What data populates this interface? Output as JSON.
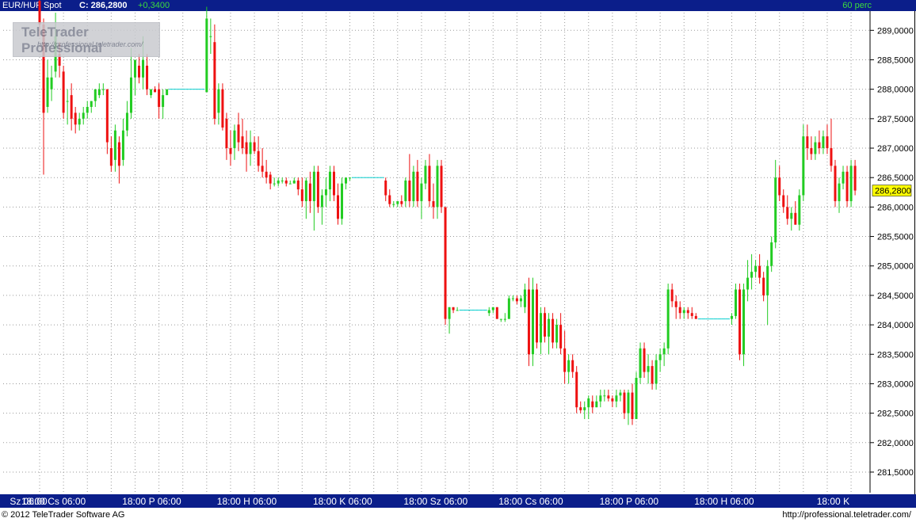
{
  "header": {
    "symbol": "EUR/HUF Spot",
    "close_label": "C: 286,2800",
    "change": "+0,3400",
    "interval": "60 perc"
  },
  "watermark": {
    "brand": "TeleTrader Professional",
    "url": "http://professional.teletrader.com/"
  },
  "footer": {
    "copyright": "© 2012 TeleTrader Software AG",
    "url": "http://professional.teletrader.com/"
  },
  "colors": {
    "up": "#22cc22",
    "down": "#ee1111",
    "background": "#ffffff",
    "bar": "#0b1e8a",
    "last_price_tag": "#ffff00",
    "connector": "#00cccc"
  },
  "chart_data": {
    "type": "candlestick",
    "ylim": [
      281.15,
      289.3
    ],
    "y_axis_side": "right",
    "grid": true,
    "last_price": 286.28,
    "last_price_label": "286,2800",
    "y_ticks": [
      {
        "value": 281.5,
        "label": "281,5000"
      },
      {
        "value": 282.0,
        "label": "282,0000"
      },
      {
        "value": 282.5,
        "label": "282,5000"
      },
      {
        "value": 283.0,
        "label": "283,0000"
      },
      {
        "value": 283.5,
        "label": "283,5000"
      },
      {
        "value": 284.0,
        "label": "284,0000"
      },
      {
        "value": 284.5,
        "label": "284,5000"
      },
      {
        "value": 285.0,
        "label": "285,0000"
      },
      {
        "value": 285.5,
        "label": "285,5000"
      },
      {
        "value": 286.0,
        "label": "286,0000"
      },
      {
        "value": 286.5,
        "label": "286,5000"
      },
      {
        "value": 287.0,
        "label": "287,0000"
      },
      {
        "value": 287.5,
        "label": "287,5000"
      },
      {
        "value": 288.0,
        "label": "288,0000"
      },
      {
        "value": 288.5,
        "label": "288,5000"
      },
      {
        "value": 289.0,
        "label": "289,0000"
      }
    ],
    "x_ticks": [
      {
        "i": 0,
        "label": "Sz 06:00"
      },
      {
        "i": 12,
        "label": "18:00 Cs 06:00"
      },
      {
        "i": 36,
        "label": "18:00  P  06:00"
      },
      {
        "i": 60,
        "label": "18:00  H  06:00"
      },
      {
        "i": 84,
        "label": "18:00  K  06:00"
      },
      {
        "i": 108,
        "label": "18:00 Sz 06:00"
      },
      {
        "i": 132,
        "label": "18:00 Cs 06:00"
      },
      {
        "i": 156,
        "label": "18:00  P  06:00"
      },
      {
        "i": 180,
        "label": "18:00  H  06:00"
      },
      {
        "i": 204,
        "label": "18:00  K"
      }
    ],
    "grid_indices": [
      0,
      6,
      12,
      18,
      24,
      30,
      36,
      42,
      48,
      54,
      60,
      66,
      72,
      78,
      84,
      90,
      96,
      102,
      108,
      114,
      120,
      126,
      132,
      138,
      144,
      150,
      156,
      162,
      168,
      174,
      180,
      186,
      192,
      198,
      204
    ],
    "ohlc": [
      [
        289.5,
        289.6,
        288.9,
        289.1
      ],
      [
        289.1,
        289.2,
        286.55,
        287.6
      ],
      [
        287.7,
        288.5,
        287.6,
        288.2
      ],
      [
        288.0,
        288.4,
        287.8,
        288.2
      ],
      [
        288.3,
        289.3,
        288.2,
        288.9
      ],
      [
        288.6,
        288.8,
        288.2,
        288.4
      ],
      [
        288.3,
        288.4,
        287.5,
        287.6
      ],
      [
        287.8,
        288.0,
        287.4,
        287.8
      ],
      [
        287.9,
        288.1,
        287.3,
        287.5
      ],
      [
        287.6,
        287.7,
        287.25,
        287.4
      ],
      [
        287.4,
        287.6,
        287.3,
        287.5
      ],
      [
        287.5,
        287.7,
        287.4,
        287.6
      ],
      [
        287.6,
        287.8,
        287.5,
        287.7
      ],
      [
        287.7,
        287.8,
        287.6,
        287.8
      ],
      [
        287.8,
        288.0,
        287.7,
        288.0
      ],
      [
        287.9,
        288.1,
        287.85,
        288.0
      ],
      [
        288.0,
        288.1,
        287.9,
        288.0
      ],
      [
        288.0,
        288.0,
        286.9,
        287.1
      ],
      [
        287.0,
        287.2,
        286.6,
        286.7
      ],
      [
        286.8,
        287.4,
        286.6,
        287.3
      ],
      [
        287.1,
        287.2,
        286.4,
        286.7
      ],
      [
        286.8,
        287.5,
        286.7,
        287.3
      ],
      [
        287.3,
        287.8,
        287.2,
        287.6
      ],
      [
        287.6,
        288.7,
        287.5,
        288.2
      ],
      [
        288.2,
        288.5,
        287.9,
        288.5
      ],
      [
        288.4,
        288.6,
        288.1,
        288.2
      ],
      [
        288.2,
        288.9,
        288.0,
        288.5
      ],
      [
        288.4,
        288.6,
        287.9,
        288.0
      ],
      [
        287.9,
        288.0,
        287.85,
        288.0
      ],
      [
        288.0,
        288.05,
        287.95,
        287.95
      ],
      [
        288.0,
        288.1,
        287.5,
        287.7
      ],
      [
        287.7,
        288.0,
        287.5,
        287.9
      ],
      [
        287.9,
        288.0,
        287.9,
        288.0
      ],
      [
        288.0,
        288.0,
        288.0,
        288.0
      ],
      [
        288.0,
        288.0,
        288.0,
        288.0
      ],
      [
        288.0,
        288.0,
        288.0,
        288.0
      ],
      [
        288.0,
        288.0,
        288.0,
        288.0
      ],
      [
        288.0,
        288.0,
        288.0,
        288.0
      ],
      [
        288.0,
        288.0,
        288.0,
        288.0
      ],
      [
        288.0,
        288.0,
        288.0,
        288.0
      ],
      [
        288.0,
        288.0,
        288.0,
        288.0
      ],
      [
        288.0,
        288.0,
        288.0,
        288.0
      ],
      [
        287.95,
        289.4,
        287.95,
        289.2
      ],
      [
        288.9,
        289.2,
        288.6,
        288.9
      ],
      [
        288.8,
        289.1,
        287.4,
        287.5
      ],
      [
        287.6,
        288.1,
        287.4,
        288.0
      ],
      [
        288.0,
        288.1,
        287.3,
        287.35
      ],
      [
        287.5,
        287.6,
        286.8,
        287.0
      ],
      [
        287.0,
        287.3,
        286.7,
        286.9
      ],
      [
        287.0,
        287.4,
        286.8,
        287.3
      ],
      [
        287.4,
        287.6,
        286.95,
        287.1
      ],
      [
        287.2,
        287.5,
        286.9,
        287.0
      ],
      [
        287.1,
        287.3,
        286.6,
        286.9
      ],
      [
        286.9,
        287.3,
        286.7,
        287.1
      ],
      [
        287.1,
        287.2,
        286.9,
        286.95
      ],
      [
        286.95,
        287.2,
        286.6,
        286.7
      ],
      [
        286.7,
        287.0,
        286.5,
        286.6
      ],
      [
        286.6,
        286.8,
        286.4,
        286.5
      ],
      [
        286.55,
        286.6,
        286.3,
        286.4
      ],
      [
        286.4,
        286.5,
        286.35,
        286.4
      ],
      [
        286.4,
        286.5,
        286.35,
        286.45
      ],
      [
        286.45,
        286.5,
        286.4,
        286.45
      ],
      [
        286.45,
        286.5,
        286.35,
        286.4
      ],
      [
        286.4,
        286.45,
        286.4,
        286.4
      ],
      [
        286.4,
        286.5,
        286.4,
        286.45
      ],
      [
        286.45,
        286.5,
        286.2,
        286.3
      ],
      [
        286.3,
        286.5,
        286.0,
        286.1
      ],
      [
        286.1,
        286.5,
        285.8,
        286.45
      ],
      [
        286.4,
        286.6,
        285.9,
        286.1
      ],
      [
        286.1,
        286.7,
        285.6,
        286.6
      ],
      [
        286.6,
        286.7,
        285.9,
        286.0
      ],
      [
        286.0,
        286.3,
        285.7,
        286.2
      ],
      [
        286.2,
        286.5,
        286.0,
        286.3
      ],
      [
        286.3,
        286.7,
        286.1,
        286.6
      ],
      [
        286.6,
        286.7,
        286.1,
        286.2
      ],
      [
        286.2,
        286.4,
        285.7,
        285.8
      ],
      [
        285.8,
        286.5,
        285.7,
        286.4
      ],
      [
        286.4,
        286.5,
        286.3,
        286.5
      ],
      [
        286.5,
        286.5,
        286.45,
        286.5
      ],
      [
        286.5,
        286.5,
        286.5,
        286.5
      ],
      [
        286.5,
        286.5,
        286.5,
        286.5
      ],
      [
        286.5,
        286.5,
        286.5,
        286.5
      ],
      [
        286.5,
        286.5,
        286.5,
        286.5
      ],
      [
        286.5,
        286.5,
        286.5,
        286.5
      ],
      [
        286.5,
        286.5,
        286.5,
        286.5
      ],
      [
        286.5,
        286.5,
        286.5,
        286.5
      ],
      [
        286.5,
        286.5,
        286.5,
        286.5
      ],
      [
        286.45,
        286.5,
        286.1,
        286.2
      ],
      [
        286.2,
        286.3,
        286.0,
        286.05
      ],
      [
        286.05,
        286.1,
        286.0,
        286.05
      ],
      [
        286.05,
        286.1,
        286.0,
        286.1
      ],
      [
        286.1,
        286.2,
        286.0,
        286.05
      ],
      [
        286.1,
        286.5,
        286.0,
        286.45
      ],
      [
        286.45,
        286.9,
        286.0,
        286.1
      ],
      [
        286.1,
        286.7,
        286.0,
        286.6
      ],
      [
        286.6,
        286.8,
        286.0,
        286.1
      ],
      [
        286.1,
        286.5,
        285.8,
        286.4
      ],
      [
        286.4,
        286.8,
        286.3,
        286.7
      ],
      [
        286.7,
        286.9,
        286.0,
        286.1
      ],
      [
        286.1,
        286.4,
        285.8,
        286.0
      ],
      [
        286.0,
        286.8,
        285.8,
        286.7
      ],
      [
        286.7,
        286.8,
        285.9,
        286.0
      ],
      [
        286.0,
        285.9,
        284.0,
        284.1
      ],
      [
        284.1,
        284.3,
        283.85,
        284.3
      ],
      [
        284.3,
        284.3,
        284.2,
        284.25
      ],
      [
        284.25,
        284.3,
        284.25,
        284.25
      ],
      [
        284.25,
        284.25,
        284.25,
        284.25
      ],
      [
        284.25,
        284.25,
        284.25,
        284.25
      ],
      [
        284.25,
        284.25,
        284.25,
        284.25
      ],
      [
        284.25,
        284.25,
        284.25,
        284.25
      ],
      [
        284.25,
        284.25,
        284.25,
        284.25
      ],
      [
        284.25,
        284.25,
        284.25,
        284.25
      ],
      [
        284.25,
        284.25,
        284.25,
        284.25
      ],
      [
        284.2,
        284.3,
        284.15,
        284.25
      ],
      [
        284.25,
        284.3,
        284.2,
        284.3
      ],
      [
        284.3,
        284.3,
        284.1,
        284.1
      ],
      [
        284.1,
        284.1,
        284.05,
        284.1
      ],
      [
        284.1,
        284.2,
        284.05,
        284.1
      ],
      [
        284.1,
        284.5,
        284.1,
        284.45
      ],
      [
        284.45,
        284.5,
        284.4,
        284.45
      ],
      [
        284.45,
        284.5,
        284.35,
        284.4
      ],
      [
        284.4,
        284.5,
        284.3,
        284.45
      ],
      [
        284.3,
        284.7,
        284.2,
        284.6
      ],
      [
        284.6,
        284.8,
        283.3,
        283.5
      ],
      [
        283.5,
        284.8,
        283.3,
        284.6
      ],
      [
        284.6,
        284.7,
        283.6,
        283.7
      ],
      [
        283.7,
        284.3,
        283.5,
        284.2
      ],
      [
        284.2,
        284.3,
        283.7,
        283.8
      ],
      [
        283.8,
        284.2,
        283.5,
        284.1
      ],
      [
        284.1,
        284.2,
        283.6,
        283.7
      ],
      [
        283.7,
        284.1,
        283.6,
        284.0
      ],
      [
        284.0,
        284.2,
        283.5,
        283.6
      ],
      [
        283.6,
        283.9,
        283.0,
        283.2
      ],
      [
        283.2,
        283.5,
        283.0,
        283.4
      ],
      [
        283.4,
        283.5,
        283.1,
        283.2
      ],
      [
        283.2,
        283.3,
        282.5,
        282.6
      ],
      [
        282.6,
        282.7,
        282.5,
        282.55
      ],
      [
        282.55,
        282.7,
        282.4,
        282.6
      ],
      [
        282.6,
        282.8,
        282.4,
        282.75
      ],
      [
        282.7,
        282.8,
        282.5,
        282.6
      ],
      [
        282.6,
        282.8,
        282.6,
        282.7
      ],
      [
        282.7,
        282.9,
        282.6,
        282.8
      ],
      [
        282.8,
        282.9,
        282.7,
        282.8
      ],
      [
        282.8,
        282.9,
        282.7,
        282.75
      ],
      [
        282.75,
        282.8,
        282.6,
        282.7
      ],
      [
        282.7,
        282.9,
        282.6,
        282.8
      ],
      [
        282.8,
        282.9,
        282.7,
        282.85
      ],
      [
        282.85,
        282.9,
        282.4,
        282.5
      ],
      [
        282.5,
        282.9,
        282.3,
        282.85
      ],
      [
        282.85,
        283.0,
        282.3,
        282.4
      ],
      [
        282.4,
        283.2,
        282.4,
        283.1
      ],
      [
        283.1,
        283.7,
        283.0,
        283.6
      ],
      [
        283.6,
        283.7,
        283.1,
        283.2
      ],
      [
        283.2,
        283.5,
        283.0,
        283.3
      ],
      [
        283.3,
        283.4,
        282.9,
        283.0
      ],
      [
        283.0,
        283.5,
        282.9,
        283.4
      ],
      [
        283.4,
        283.6,
        283.2,
        283.5
      ],
      [
        283.5,
        283.7,
        283.3,
        283.6
      ],
      [
        283.6,
        284.7,
        283.5,
        284.6
      ],
      [
        284.6,
        284.7,
        284.3,
        284.4
      ],
      [
        284.4,
        284.5,
        284.1,
        284.3
      ],
      [
        284.3,
        284.4,
        284.1,
        284.2
      ],
      [
        284.2,
        284.3,
        284.1,
        284.25
      ],
      [
        284.25,
        284.3,
        284.1,
        284.2
      ],
      [
        284.2,
        284.3,
        284.1,
        284.15
      ],
      [
        284.15,
        284.2,
        284.1,
        284.1
      ],
      [
        284.1,
        284.1,
        284.1,
        284.1
      ],
      [
        284.1,
        284.1,
        284.1,
        284.1
      ],
      [
        284.1,
        284.1,
        284.1,
        284.1
      ],
      [
        284.1,
        284.1,
        284.1,
        284.1
      ],
      [
        284.1,
        284.1,
        284.1,
        284.1
      ],
      [
        284.1,
        284.1,
        284.1,
        284.1
      ],
      [
        284.1,
        284.1,
        284.1,
        284.1
      ],
      [
        284.1,
        284.1,
        284.1,
        284.1
      ],
      [
        284.1,
        284.2,
        284.0,
        284.15
      ],
      [
        284.15,
        284.7,
        284.1,
        284.6
      ],
      [
        284.6,
        284.7,
        283.4,
        283.5
      ],
      [
        283.5,
        284.7,
        283.3,
        284.6
      ],
      [
        284.6,
        285.1,
        284.4,
        284.8
      ],
      [
        284.8,
        285.2,
        284.6,
        284.9
      ],
      [
        284.9,
        285.1,
        284.8,
        285.0
      ],
      [
        285.0,
        285.2,
        284.7,
        284.8
      ],
      [
        284.8,
        284.9,
        284.4,
        284.5
      ],
      [
        284.5,
        285.1,
        284.0,
        285.0
      ],
      [
        285.0,
        285.5,
        284.9,
        285.4
      ],
      [
        285.4,
        286.8,
        285.3,
        286.5
      ],
      [
        286.5,
        286.7,
        286.1,
        286.2
      ],
      [
        286.2,
        286.3,
        285.9,
        286.0
      ],
      [
        286.0,
        286.2,
        285.7,
        285.8
      ],
      [
        285.8,
        286.0,
        285.6,
        285.9
      ],
      [
        285.9,
        286.1,
        285.7,
        285.7
      ],
      [
        285.7,
        286.3,
        285.6,
        286.2
      ],
      [
        286.2,
        287.4,
        286.1,
        287.2
      ],
      [
        287.2,
        287.4,
        286.8,
        287.0
      ],
      [
        287.0,
        287.2,
        286.8,
        286.9
      ],
      [
        286.9,
        287.2,
        286.8,
        287.1
      ],
      [
        287.1,
        287.3,
        286.9,
        287.0
      ],
      [
        287.0,
        287.3,
        286.9,
        287.2
      ],
      [
        287.2,
        287.4,
        286.9,
        287.0
      ],
      [
        287.0,
        287.5,
        286.6,
        286.7
      ],
      [
        286.7,
        286.8,
        286.0,
        286.1
      ],
      [
        286.1,
        286.5,
        285.9,
        286.4
      ],
      [
        286.4,
        286.7,
        286.3,
        286.6
      ],
      [
        286.6,
        286.7,
        286.0,
        286.1
      ],
      [
        286.1,
        286.8,
        286.0,
        286.7
      ],
      [
        286.7,
        286.8,
        286.2,
        286.28
      ]
    ]
  }
}
